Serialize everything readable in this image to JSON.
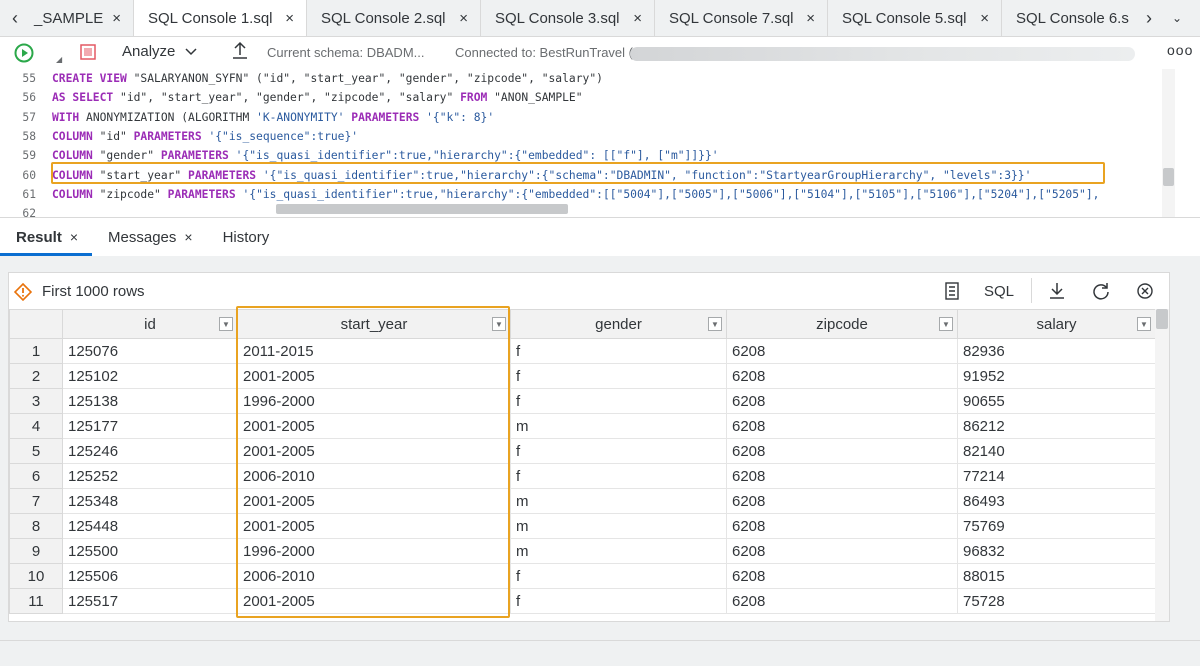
{
  "tabs": [
    {
      "label": "_SAMPLE",
      "active": false
    },
    {
      "label": "SQL Console 1.sql",
      "active": true
    },
    {
      "label": "SQL Console 2.sql",
      "active": false
    },
    {
      "label": "SQL Console 3.sql",
      "active": false
    },
    {
      "label": "SQL Console 7.sql",
      "active": false
    },
    {
      "label": "SQL Console 5.sql",
      "active": false
    },
    {
      "label": "SQL Console 6.s",
      "active": false
    }
  ],
  "tab_close_glyph": "×",
  "toolbar": {
    "analyze_label": "Analyze",
    "schema_label": "Current schema: DBADM...",
    "connected_label": "Connected to: BestRunTravel (",
    "overflow_glyph": "ooo"
  },
  "editor": {
    "lines": [
      {
        "num": "55",
        "text": "CREATE VIEW \"SALARYANON_SYFN\" (\"id\", \"start_year\", \"gender\", \"zipcode\", \"salary\")"
      },
      {
        "num": "56",
        "text": "AS SELECT \"id\", \"start_year\", \"gender\", \"zipcode\", \"salary\" FROM \"ANON_SAMPLE\""
      },
      {
        "num": "57",
        "text": "WITH ANONYMIZATION (ALGORITHM 'K-ANONYMITY' PARAMETERS '{\"k\": 8}'"
      },
      {
        "num": "58",
        "text": "COLUMN \"id\" PARAMETERS '{\"is_sequence\":true}'"
      },
      {
        "num": "59",
        "text": "COLUMN \"gender\" PARAMETERS '{\"is_quasi_identifier\":true,\"hierarchy\":{\"embedded\": [[\"f\"], [\"m\"]]}}'"
      },
      {
        "num": "60",
        "text": "COLUMN \"start_year\" PARAMETERS '{\"is_quasi_identifier\":true,\"hierarchy\":{\"schema\":\"DBADMIN\", \"function\":\"StartyearGroupHierarchy\", \"levels\":3}}'"
      },
      {
        "num": "61",
        "text": "COLUMN \"zipcode\" PARAMETERS '{\"is_quasi_identifier\":true,\"hierarchy\":{\"embedded\":[[\"5004\"],[\"5005\"],[\"5006\"],[\"5104\"],[\"5105\"],[\"5106\"],[\"5204\"],[\"5205\"],"
      },
      {
        "num": "62",
        "text": ""
      }
    ]
  },
  "result_tabs": [
    {
      "label": "Result",
      "active": true,
      "closable": true
    },
    {
      "label": "Messages",
      "active": false,
      "closable": true
    },
    {
      "label": "History",
      "active": false,
      "closable": false
    }
  ],
  "result": {
    "rows_label": "First 1000 rows",
    "sql_label": "SQL",
    "columns": [
      "id",
      "start_year",
      "gender",
      "zipcode",
      "salary"
    ],
    "rows": [
      [
        "1",
        "125076",
        "2011-2015",
        "f",
        "6208",
        "82936"
      ],
      [
        "2",
        "125102",
        "2001-2005",
        "f",
        "6208",
        "91952"
      ],
      [
        "3",
        "125138",
        "1996-2000",
        "f",
        "6208",
        "90655"
      ],
      [
        "4",
        "125177",
        "2001-2005",
        "m",
        "6208",
        "86212"
      ],
      [
        "5",
        "125246",
        "2001-2005",
        "f",
        "6208",
        "82140"
      ],
      [
        "6",
        "125252",
        "2006-2010",
        "f",
        "6208",
        "77214"
      ],
      [
        "7",
        "125348",
        "2001-2005",
        "m",
        "6208",
        "86493"
      ],
      [
        "8",
        "125448",
        "2001-2005",
        "m",
        "6208",
        "75769"
      ],
      [
        "9",
        "125500",
        "1996-2000",
        "m",
        "6208",
        "96832"
      ],
      [
        "10",
        "125506",
        "2006-2010",
        "f",
        "6208",
        "88015"
      ],
      [
        "11",
        "125517",
        "2001-2005",
        "f",
        "6208",
        "75728"
      ]
    ]
  },
  "colors": {
    "highlight": "#e9a321",
    "keyword": "#9b2cb6",
    "string": "#2b5a9e",
    "run": "#2ba84a",
    "stop": "#e45863",
    "active_tab_underline": "#0a6ed1"
  }
}
